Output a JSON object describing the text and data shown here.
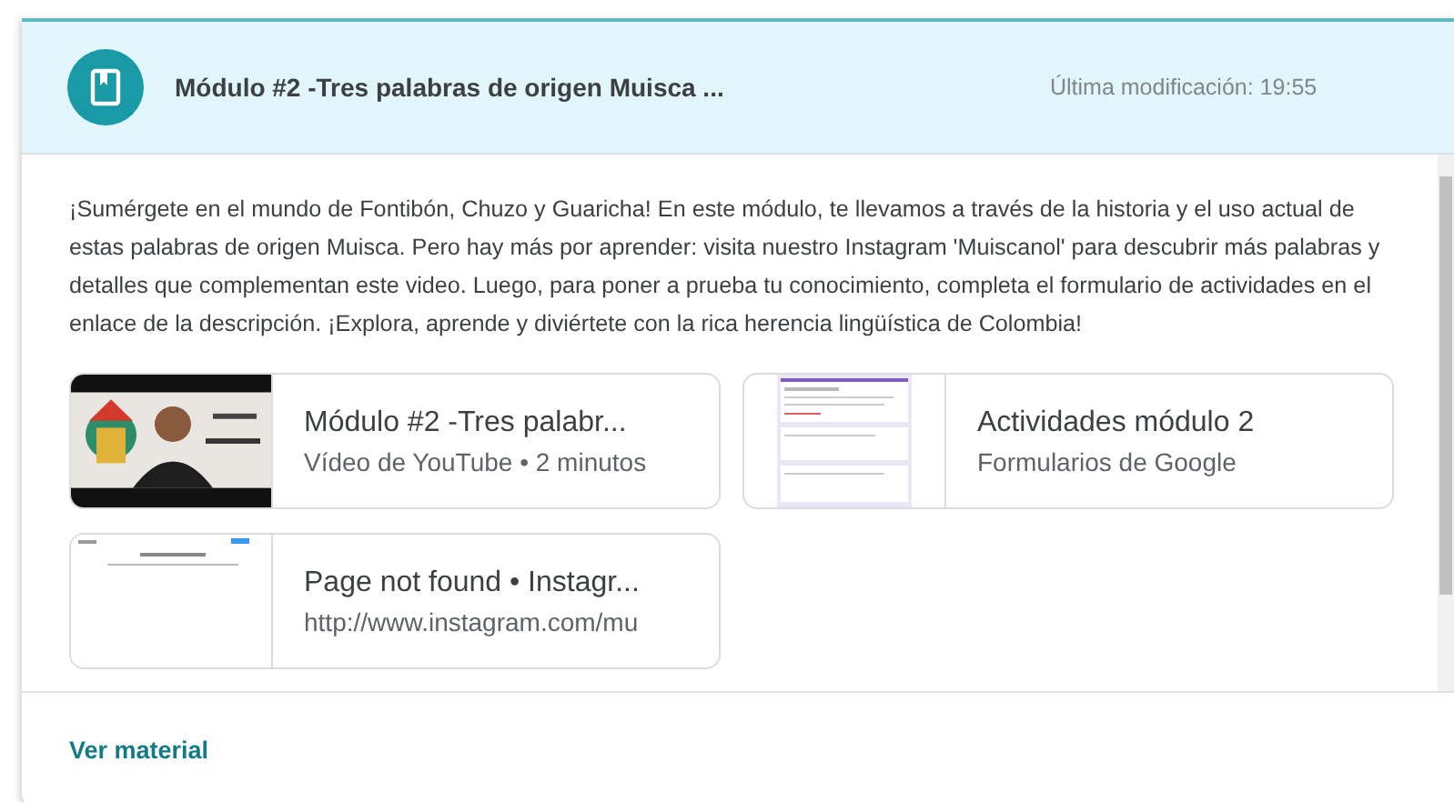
{
  "header": {
    "title": "Módulo #2 -Tres palabras de origen Muisca ...",
    "modified": "Última modificación: 19:55"
  },
  "description": "¡Sumérgete en el mundo de Fontibón, Chuzo y Guaricha! En este módulo, te llevamos a través de la historia y el uso actual de estas palabras de origen Muisca. Pero hay más por aprender: visita nuestro Instagram 'Muiscanol' para descubrir más palabras y detalles que complementan este video. Luego, para poner a prueba tu conocimiento, completa el formulario de actividades en el enlace de la descripción. ¡Explora, aprende y diviértete con la rica herencia lingüística de Colombia!",
  "attachments": [
    {
      "kind": "video",
      "title": "Módulo #2 -Tres palabr...",
      "subtitle": "Vídeo de YouTube • 2 minutos"
    },
    {
      "kind": "form",
      "title": "Actividades módulo 2",
      "subtitle": "Formularios de Google"
    },
    {
      "kind": "webpage",
      "title": "Page not found • Instagr...",
      "subtitle": "http://www.instagram.com/mu"
    }
  ],
  "footer": {
    "link": "Ver material"
  }
}
